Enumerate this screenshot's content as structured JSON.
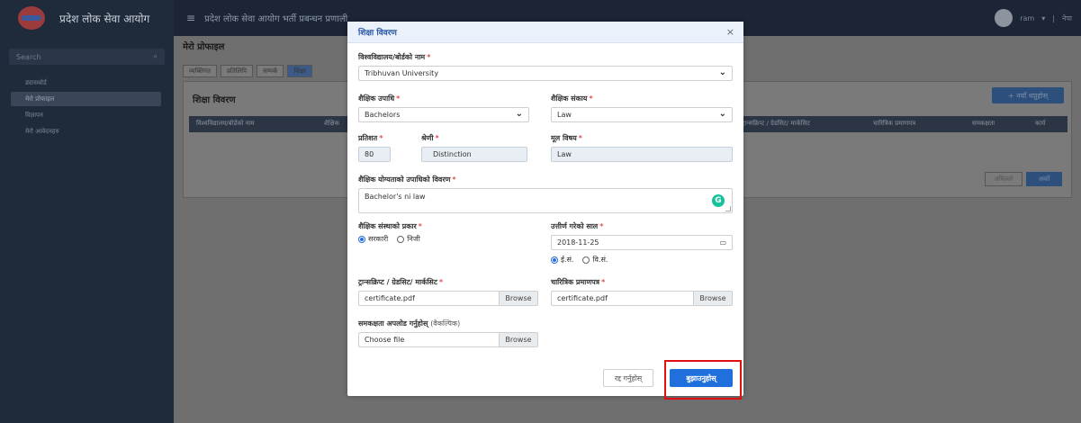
{
  "app": {
    "brand": "प्रदेश लोक सेवा आयोग",
    "topbar_title": "प्रदेश लोक सेवा आयोग भर्ती प्रबन्धन प्रणाली",
    "user": "ram",
    "user_caret": "▾",
    "lang": "नेपा",
    "search_placeholder": "Search"
  },
  "sidebar": {
    "items": [
      {
        "label": "ड्यासबोर्ड"
      },
      {
        "label": "मेरो प्रोफाइल"
      },
      {
        "label": "विज्ञापन"
      },
      {
        "label": "मेरो आवेदनहरु"
      }
    ]
  },
  "profile": {
    "title": "मेरो प्रोफाइल",
    "tabs": [
      "व्यक्तिगत",
      "प्रतिलिपि",
      "सम्पर्क",
      "शिक्षा"
    ],
    "card_title": "शिक्षा विवरण",
    "add_button": "+ नयाँ थप्नुहोस्",
    "columns": [
      "विश्वविद्यालय/बोर्डको नाम",
      "शैक्षिक",
      "ट्रान्सक्रिप्ट / ग्रेडसिट/ मार्कसिट",
      "चारित्रिक प्रमाणपत्र",
      "समकक्षता",
      "कार्य"
    ],
    "prev": "अघिल्लो",
    "next": "अर्को"
  },
  "modal": {
    "title": "शिक्षा विवरण",
    "close": "×",
    "university_label": "विश्वविद्यालय/बोर्डको नाम",
    "university_value": "Tribhuvan University",
    "degree_label": "शैक्षिक उपाधि",
    "degree_value": "Bachelors",
    "faculty_label": "शैक्षिक संकाय",
    "faculty_value": "Law",
    "percent_label": "प्रतिशत",
    "percent_value": "80",
    "division_label": "श्रेणी",
    "division_value": "Distinction",
    "subject_label": "मूल विषय",
    "subject_value": "Law",
    "desc_label": "शैक्षिक योग्यताको उपाधिको विवरण",
    "desc_value": "Bachelor's ni law",
    "inst_type_label": "शैक्षिक संस्थाको प्रकार",
    "inst_type_options": [
      "सरकारी",
      "निजी"
    ],
    "inst_type_selected": "सरकारी",
    "pass_year_label": "उत्तीर्ण गरेको साल",
    "pass_year_value": "2018-11-25",
    "calendar_options": [
      "ई.सं.",
      "वि.सं."
    ],
    "calendar_selected": "ई.सं.",
    "transcript_label": "ट्रान्सक्रिप्ट / ग्रेडसिट/ मार्कसिट",
    "transcript_file": "certificate.pdf",
    "character_label": "चारित्रिक प्रमाणपत्र",
    "character_file": "certificate.pdf",
    "equiv_label": "समकक्षता अपलोड गर्नुहोस्",
    "equiv_optional": "(वैकल्पिक)",
    "equiv_file": "Choose file",
    "browse": "Browse",
    "required_mark": "*",
    "chevron": "❯",
    "calendar_glyph": "▭",
    "grammarly_glyph": "G",
    "cancel": "रद्द गर्नुहोस्",
    "submit": "बुझाउनुहोस्"
  },
  "colors": {
    "primary": "#1f6fdd",
    "highlight": "#e01010",
    "required": "#e05050"
  }
}
